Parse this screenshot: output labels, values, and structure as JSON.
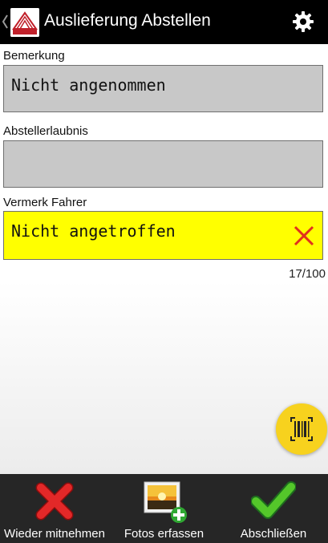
{
  "appbar": {
    "title": "Auslieferung Abstellen",
    "icons": {
      "back": "chevron-left-icon",
      "logo": "app-logo",
      "settings": "gear-icon"
    }
  },
  "fields": [
    {
      "label": "Bemerkung",
      "value": "Nicht angenommen",
      "background": "#c8c8c8"
    },
    {
      "label": "Abstellerlaubnis",
      "value": "",
      "background": "#c8c8c8"
    },
    {
      "label": "Vermerk Fahrer",
      "value": "Nicht angetroffen",
      "background": "#ffff00",
      "clear_icon": "close-icon"
    }
  ],
  "char_counter": "17/100",
  "fab": {
    "icon": "barcode-icon",
    "color": "#f7d21e"
  },
  "bottom_actions": [
    {
      "label": "Wieder mitnehmen",
      "icon": "red-x-icon"
    },
    {
      "label": "Fotos erfassen",
      "icon": "add-photo-icon"
    },
    {
      "label": "Abschließen",
      "icon": "green-check-icon"
    }
  ]
}
